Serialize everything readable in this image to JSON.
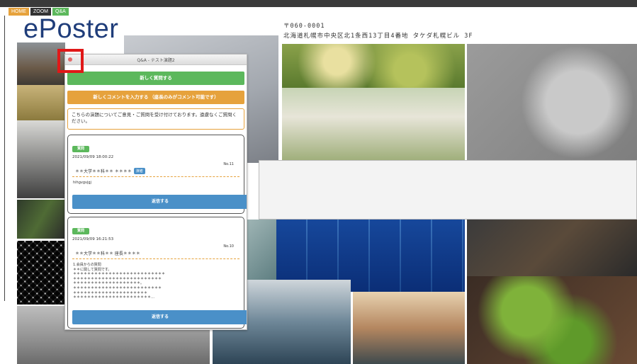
{
  "nav": {
    "home": "HOME",
    "zoom": "ZOOM",
    "qa": "Q&A"
  },
  "logo": "ePoster",
  "address": {
    "postal": "〒060-0001",
    "line": "北海道札幌市中央区北1条西13丁目4番地 タケダ札幌ビル 3F"
  },
  "colors": {
    "green": "#5cb85c",
    "orange": "#e6a23c",
    "blue": "#4a90c8",
    "highlight": "#e01818"
  },
  "qa": {
    "title": "Q&A - テスト演題2",
    "new_question_button": "新しく質問する",
    "new_comment_button": "新しくコメントを入力する （座長のみがコメント可能です）",
    "notice": "こちらの演題についてご意見・ご質問を受け付けております。遠慮なくご質問ください。",
    "questions": [
      {
        "badge": "質問",
        "date": "2021/09/09 18:00:22",
        "number": "No.11",
        "author": "＊＊大学＊＊科＊＊ ＊＊＊＊",
        "author_badge": "演者",
        "text": "hihgvgvjgj",
        "reply_button": "返信する"
      },
      {
        "badge": "質問",
        "date": "2021/09/09 16:21:53",
        "number": "No.10",
        "author": "＊＊大学＊＊科＊＊ 座長＊＊＊＊",
        "text": "1.会員からの質問\n＊＊に関して質問です。\n＊＊＊＊＊＊＊＊＊＊＊＊＊＊＊＊＊＊＊＊＊＊＊＊＊＊\n＊＊＊＊＊＊＊＊＊＊＊＊＊＊＊＊＊＊＊＊＊＊＊＊＊\n＊＊＊＊＊＊＊＊＊＊＊＊＊＊＊＊＊＊＊。\n＊＊＊＊＊＊＊＊＊＊＊＊＊＊＊＊＊＊＊＊＊＊＊＊＊\n＊＊＊＊＊＊＊＊＊＊＊＊＊＊＊＊＊＊＊＊＊\n＊＊＊＊＊＊＊＊＊＊＊＊＊＊＊＊＊＊＊＊＊＊…",
        "reply_button": "返信する"
      }
    ]
  }
}
